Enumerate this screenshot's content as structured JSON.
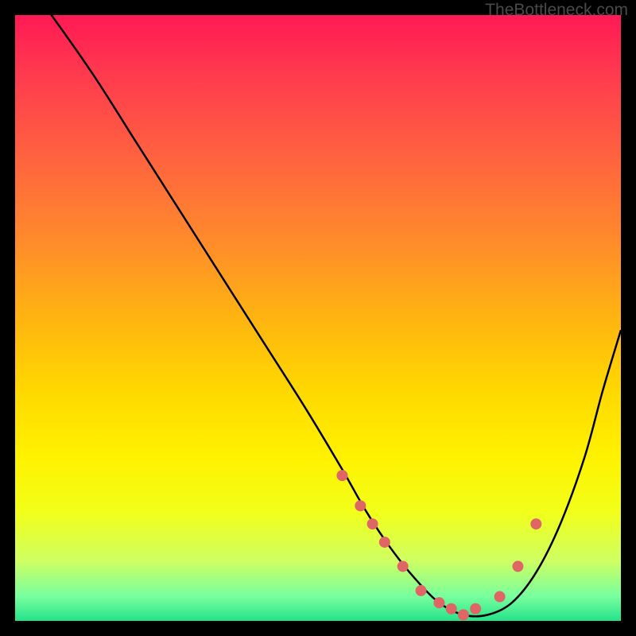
{
  "attribution": "TheBottleneck.com",
  "colors": {
    "frame_bg": "#000000",
    "curve_stroke": "#000000",
    "marker_fill": "#e06666",
    "marker_edge": "#c24e4e"
  },
  "chart_data": {
    "type": "line",
    "title": "",
    "xlabel": "",
    "ylabel": "",
    "xlim": [
      0,
      100
    ],
    "ylim": [
      0,
      100
    ],
    "series": [
      {
        "name": "bottleneck-curve",
        "x": [
          0,
          6,
          13,
          20,
          27,
          34,
          41,
          48,
          54,
          58,
          62,
          66,
          70,
          74,
          78,
          82,
          86,
          90,
          94,
          97,
          100
        ],
        "values": [
          108,
          100,
          90,
          79,
          68,
          57,
          46,
          35,
          25,
          18,
          12,
          7,
          3,
          1,
          1,
          3,
          8,
          16,
          27,
          38,
          48
        ]
      }
    ],
    "markers": {
      "name": "highlight-points",
      "x": [
        54,
        57,
        59,
        61,
        64,
        67,
        70,
        72,
        74,
        76,
        80,
        83,
        86
      ],
      "values": [
        24,
        19,
        16,
        13,
        9,
        5,
        3,
        2,
        1,
        2,
        4,
        9,
        16
      ]
    },
    "annotations": []
  }
}
